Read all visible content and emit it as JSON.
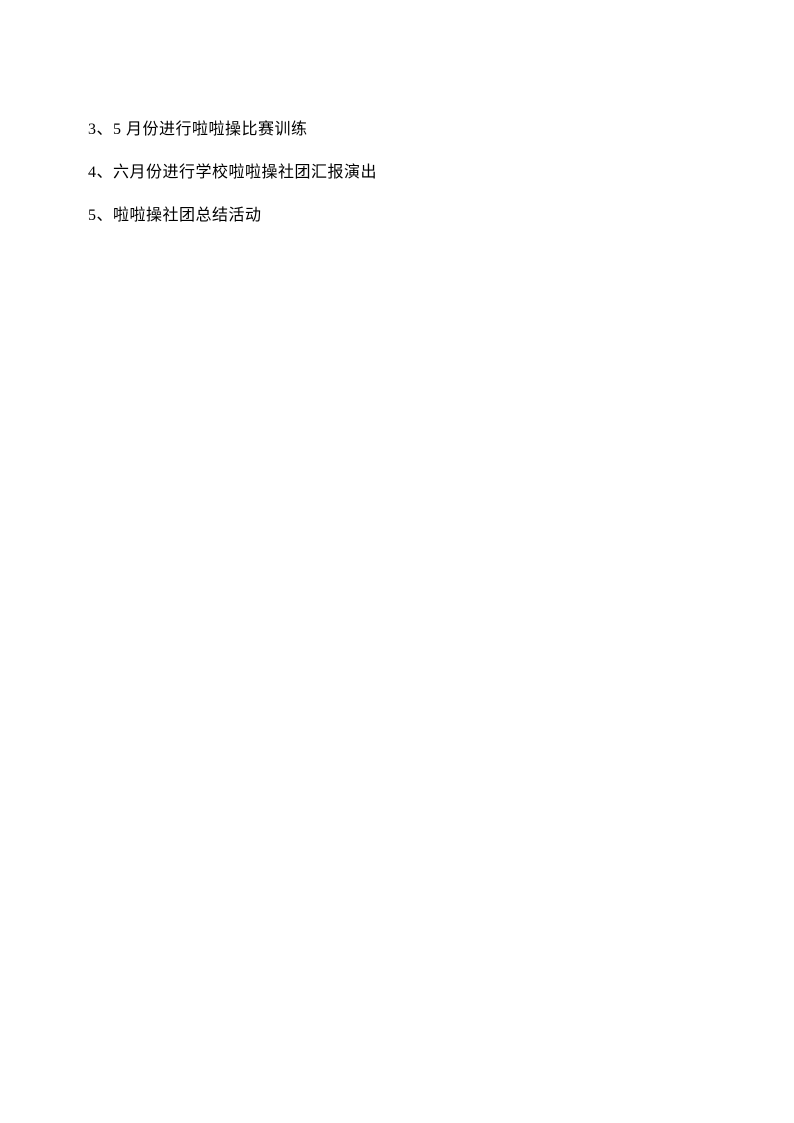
{
  "items": [
    "3、5 月份进行啦啦操比赛训练",
    "4、六月份进行学校啦啦操社团汇报演出",
    "5、啦啦操社团总结活动"
  ]
}
